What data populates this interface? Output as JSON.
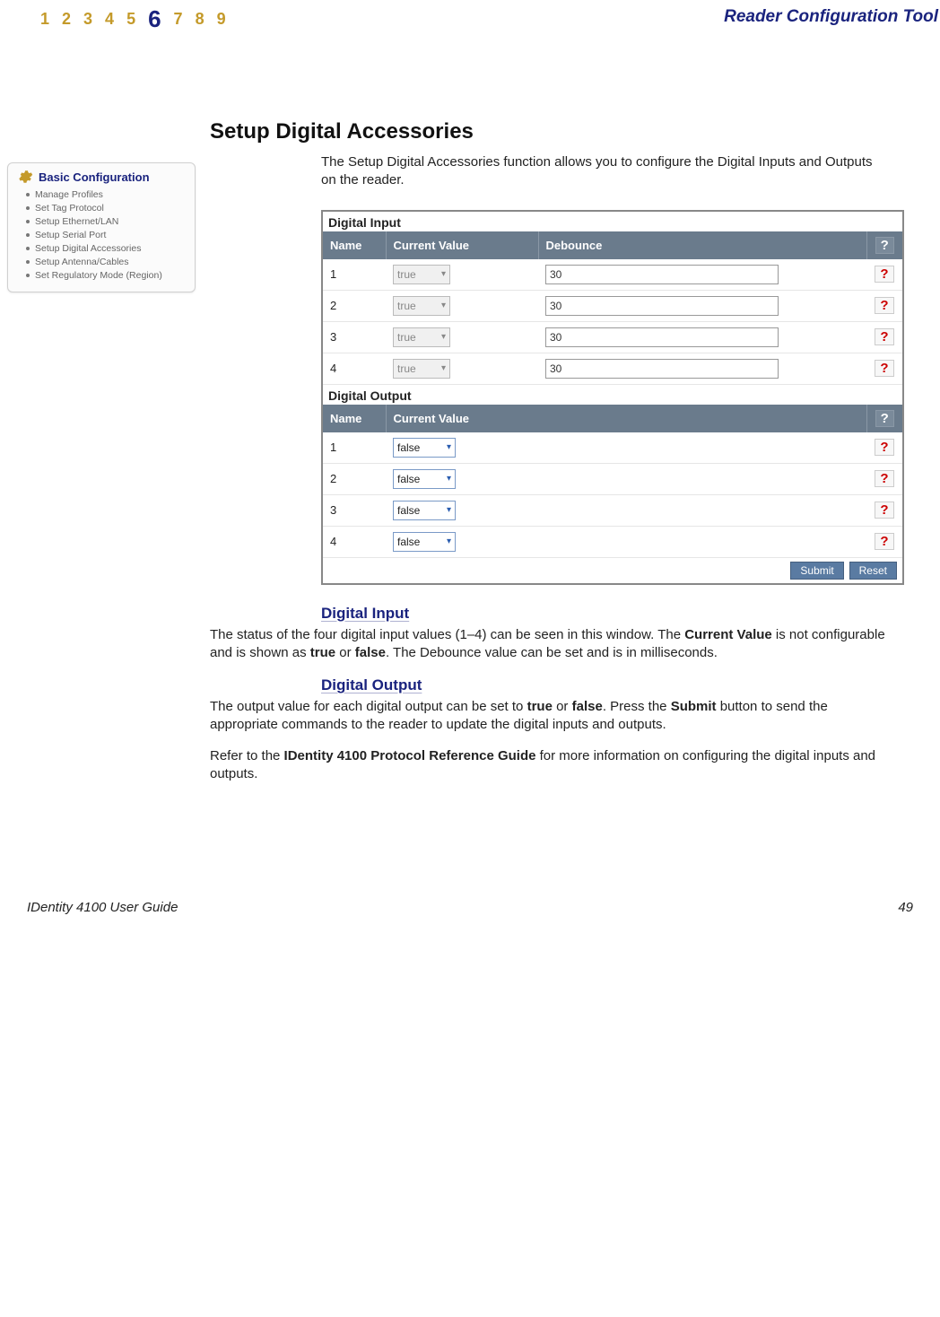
{
  "header": {
    "nav": [
      "1",
      "2",
      "3",
      "4",
      "5",
      "6",
      "7",
      "8",
      "9"
    ],
    "current_index": 5,
    "title": "Reader Configuration Tool"
  },
  "sidebar": {
    "title": "Basic Configuration",
    "items": [
      {
        "label": "Manage Profiles"
      },
      {
        "label": "Set Tag Protocol"
      },
      {
        "label": "Setup Ethernet/LAN"
      },
      {
        "label": "Setup Serial Port"
      },
      {
        "label": "Setup Digital Accessories"
      },
      {
        "label": "Setup Antenna/Cables"
      },
      {
        "label": "Set Regulatory Mode (Region)"
      }
    ]
  },
  "main": {
    "section_title": "Setup Digital Accessories",
    "intro": "The Setup Digital Accessories function allows you to configure the Digital Inputs and Outputs on the reader.",
    "panel": {
      "input_section": "Digital Input",
      "output_section": "Digital Output",
      "headers": {
        "name": "Name",
        "current_value": "Current Value",
        "debounce": "Debounce",
        "help": "?"
      },
      "inputs": [
        {
          "name": "1",
          "value": "true",
          "debounce": "30"
        },
        {
          "name": "2",
          "value": "true",
          "debounce": "30"
        },
        {
          "name": "3",
          "value": "true",
          "debounce": "30"
        },
        {
          "name": "4",
          "value": "true",
          "debounce": "30"
        }
      ],
      "outputs": [
        {
          "name": "1",
          "value": "false"
        },
        {
          "name": "2",
          "value": "false"
        },
        {
          "name": "3",
          "value": "false"
        },
        {
          "name": "4",
          "value": "false"
        }
      ],
      "buttons": {
        "submit": "Submit",
        "reset": "Reset"
      },
      "row_help": "?"
    },
    "sub1": {
      "title": "Digital Input",
      "p1a": "The status of the four digital input values (1–4) can be seen in this window. The ",
      "b1": "Current Value",
      "p1b": " is not configurable and is shown as ",
      "b2": "true",
      "p1c": " or ",
      "b3": "false",
      "p1d": ". The Debounce value can be set and is in milliseconds."
    },
    "sub2": {
      "title": "Digital Output",
      "p1a": "The output value for each digital output can be set to ",
      "b1": "true",
      "p1b": " or ",
      "b2": "false",
      "p1c": ". Press the ",
      "b3": "Submit",
      "p1d": " button to send the appropriate commands to the reader to update the digital inputs and outputs."
    },
    "refer": {
      "a": "Refer to the ",
      "b": "IDentity 4100 Protocol Reference Guide",
      "c": " for more information on configuring the digital inputs and outputs."
    }
  },
  "footer": {
    "left": "IDentity 4100 User Guide",
    "right": "49"
  }
}
